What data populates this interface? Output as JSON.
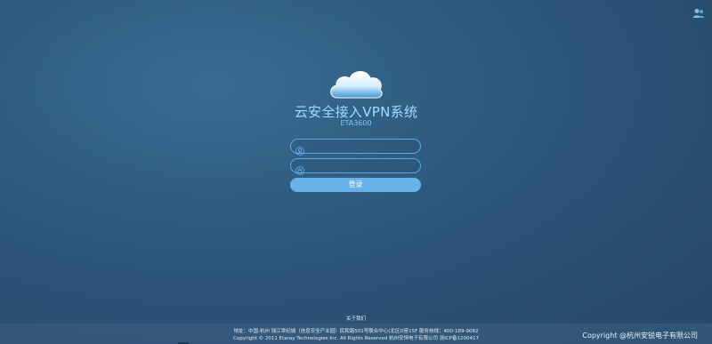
{
  "header": {
    "user_icon": "users-icon"
  },
  "logo": {
    "icon": "cloud-icon"
  },
  "app": {
    "title": "云安全接入VPN系统",
    "model": "ETA3600"
  },
  "login": {
    "username_icon": "user-icon",
    "username_value": "",
    "password_icon": "lock-icon",
    "password_value": "",
    "submit_label": "登录"
  },
  "footer": {
    "about_label": "关于我们",
    "address_line": "地址：中国-杭州 钱江世纪城（信息安全产业园）民和路501号联合中心(北区D座15F 服务热线：400-189-9082",
    "copyright_line": "Copyright © 2011 Etaray Technologies Inc. All Rights Reserved 杭州安恒电子有限公司 浙ICP备1200417",
    "brand": "Copyright @杭州安锐电子有限公司"
  },
  "colors": {
    "accent": "#68b2ea",
    "field_border": "#5aa6e3",
    "title": "#9fdcff"
  }
}
